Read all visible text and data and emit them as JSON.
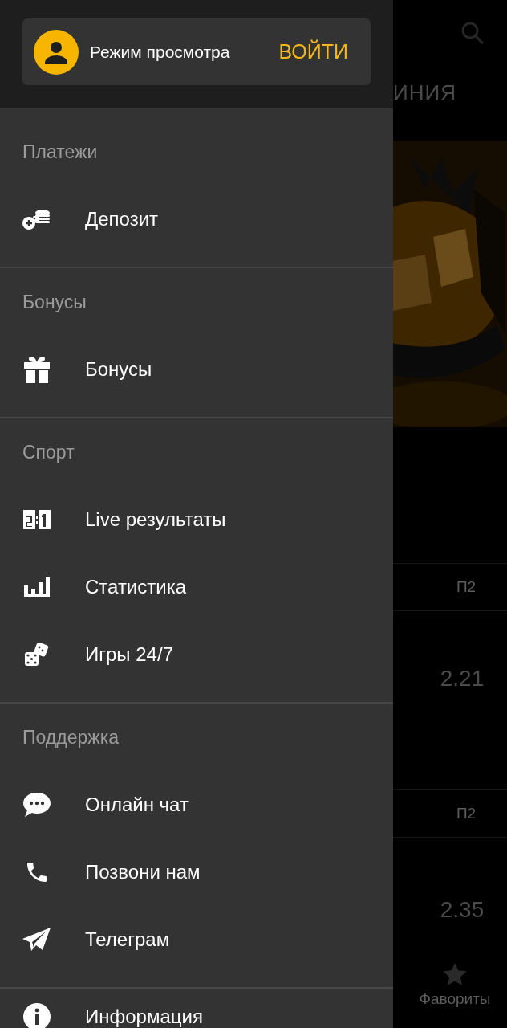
{
  "user_card": {
    "mode_label": "Режим просмотра",
    "login_button": "ВОЙТИ"
  },
  "sections": [
    {
      "title": "Платежи",
      "items": [
        {
          "label": "Депозит"
        }
      ]
    },
    {
      "title": "Бонусы",
      "items": [
        {
          "label": "Бонусы"
        }
      ]
    },
    {
      "title": "Спорт",
      "items": [
        {
          "label": "Live результаты"
        },
        {
          "label": "Статистика"
        },
        {
          "label": "Игры 24/7"
        }
      ]
    },
    {
      "title": "Поддержка",
      "items": [
        {
          "label": "Онлайн чат"
        },
        {
          "label": "Позвони нам"
        },
        {
          "label": "Телеграм"
        }
      ]
    }
  ],
  "extra_items": [
    {
      "label": "Информация"
    }
  ],
  "background": {
    "tab_label": "ИНИЯ",
    "markets": [
      {
        "header": "П2",
        "odds": "2.21"
      },
      {
        "header": "П2",
        "odds": "2.35"
      }
    ],
    "bottom_nav": {
      "label": "Фавориты"
    }
  }
}
